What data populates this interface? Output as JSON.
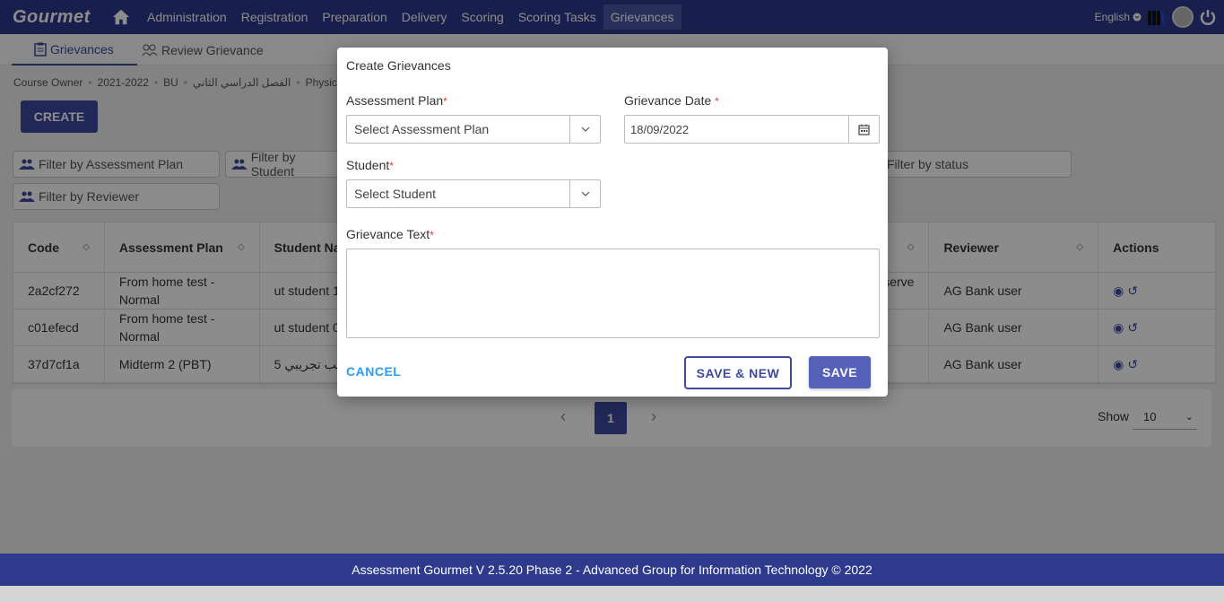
{
  "app": {
    "logo": "Gourmet"
  },
  "nav": {
    "items": [
      "Administration",
      "Registration",
      "Preparation",
      "Delivery",
      "Scoring",
      "Scoring Tasks",
      "Grievances"
    ],
    "active": "Grievances"
  },
  "topbar": {
    "language": "English"
  },
  "subtabs": [
    {
      "label": "Grievances",
      "icon": "clipboard-icon"
    },
    {
      "label": "Review Grievance",
      "icon": "review-icon"
    }
  ],
  "breadcrumb": [
    "Course Owner",
    "2021-2022",
    "BU",
    "الفصل الدراسي الثاني",
    "Physics"
  ],
  "create_label": "CREATE",
  "filters": {
    "assessment_plan": "Filter by Assessment Plan",
    "student": "Filter by Student",
    "status": "Filter by status",
    "reviewer": "Filter by Reviewer"
  },
  "table": {
    "headers": [
      "Code",
      "Assessment Plan",
      "Student Na",
      "",
      "Reviewer",
      "Actions"
    ],
    "rows": [
      {
        "code": "2a2cf272",
        "plan": "From home test - Normal",
        "student": "ut student 1",
        "status": "eserve",
        "reviewer": "AG Bank user"
      },
      {
        "code": "c01efecd",
        "plan": "From home test - Normal",
        "student": "ut student 0",
        "status": "",
        "reviewer": "AG Bank user"
      },
      {
        "code": "37d7cf1a",
        "plan": "Midterm 2 (PBT)",
        "student": "طالب تجريبي 5",
        "status": "",
        "reviewer": "AG Bank user"
      }
    ]
  },
  "pager": {
    "current": "1",
    "show_label": "Show",
    "page_size": "10"
  },
  "footer": "Assessment Gourmet V 2.5.20 Phase 2 - Advanced Group for Information Technology © 2022",
  "modal": {
    "title": "Create Grievances",
    "assessment_plan_label": "Assessment Plan",
    "assessment_plan_value": "Select Assessment Plan",
    "grievance_date_label": "Grievance Date",
    "grievance_date_value": "18/09/2022",
    "student_label": "Student",
    "student_value": "Select Student",
    "grievance_text_label": "Grievance Text",
    "required_mark": "*",
    "cancel": "CANCEL",
    "save_new": "SAVE & NEW",
    "save": "SAVE"
  },
  "colors": {
    "primary": "#2e3a8c",
    "accent": "#3d4aa0",
    "required": "#e53935",
    "link": "#2a9df4"
  }
}
